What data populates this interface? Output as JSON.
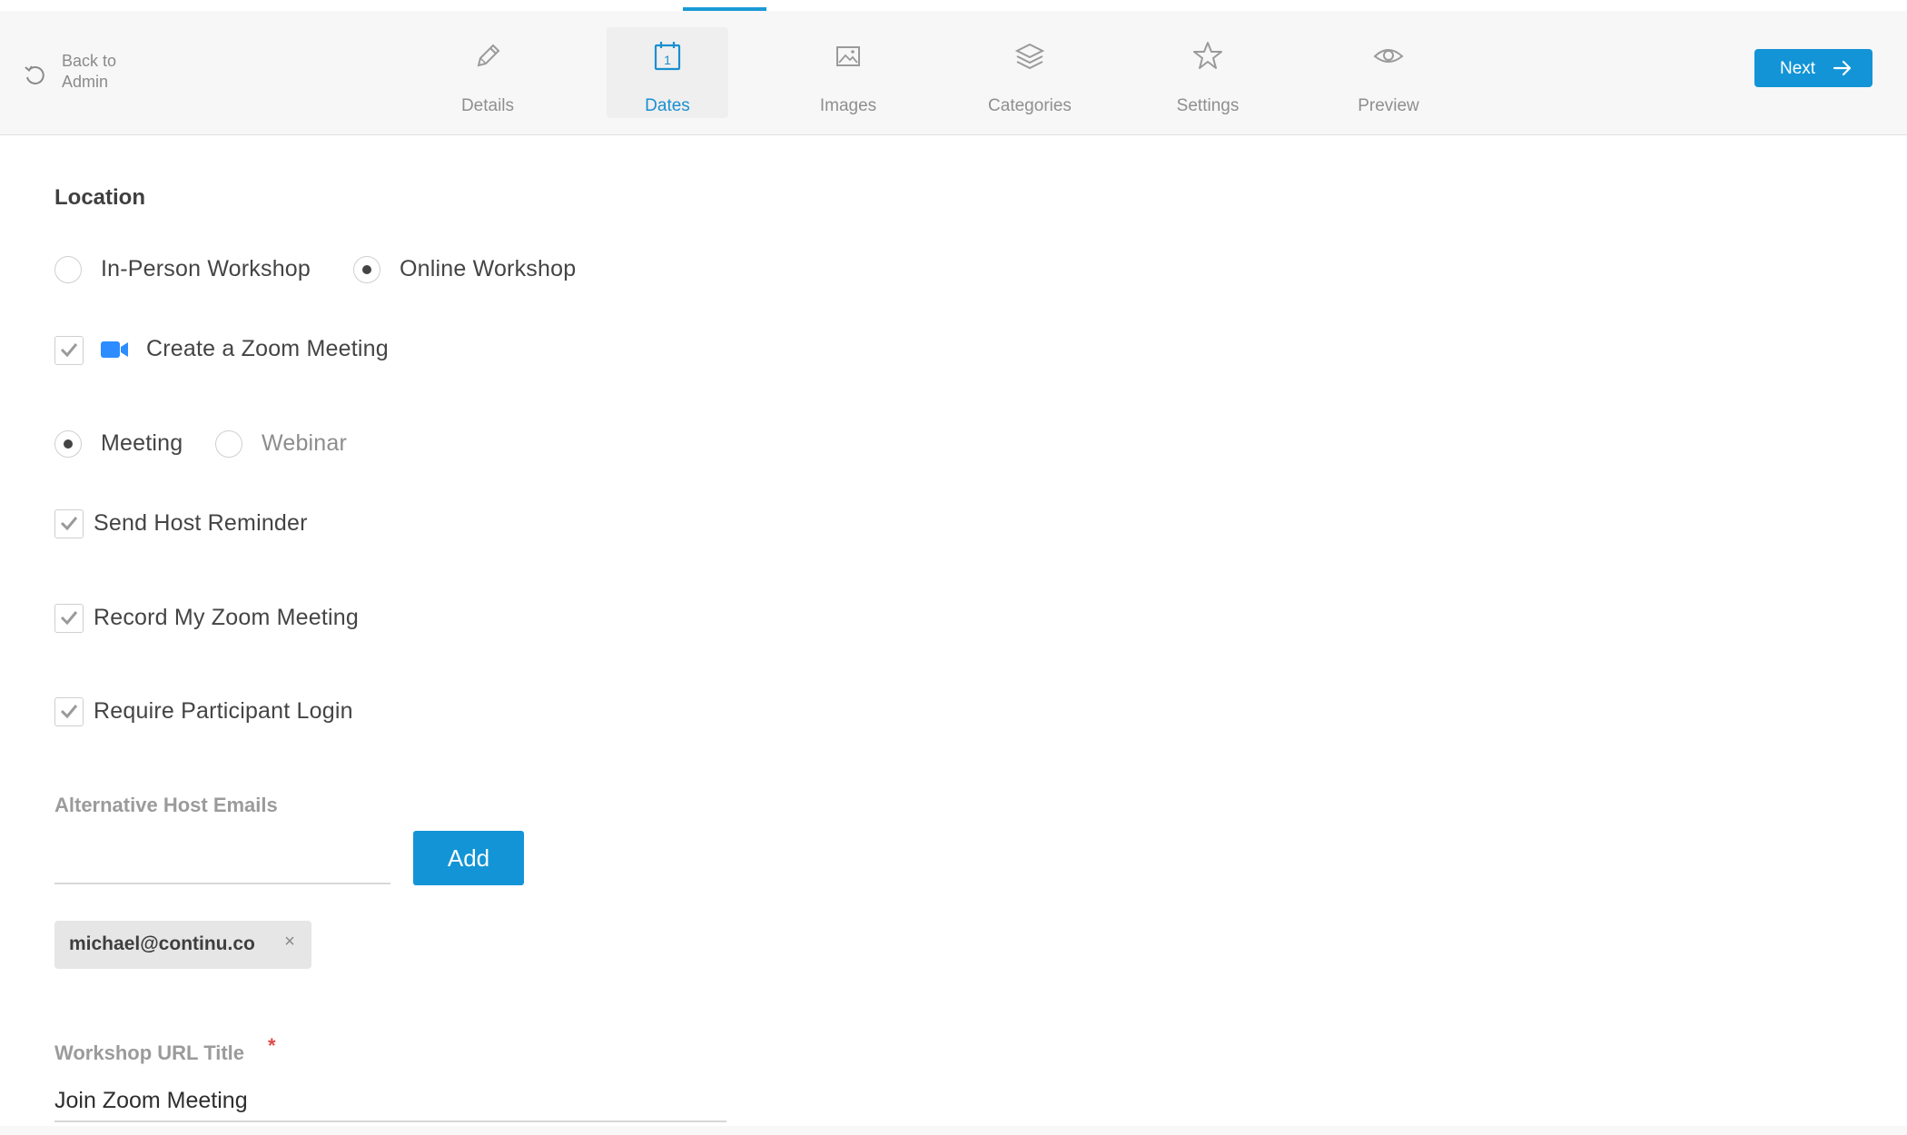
{
  "header": {
    "back_label": "Back to Admin",
    "tabs": [
      {
        "label": "Details",
        "icon": "pencil-icon",
        "active": false
      },
      {
        "label": "Dates",
        "icon": "calendar-icon",
        "active": true
      },
      {
        "label": "Images",
        "icon": "image-icon",
        "active": false
      },
      {
        "label": "Categories",
        "icon": "layers-icon",
        "active": false
      },
      {
        "label": "Settings",
        "icon": "star-icon",
        "active": false
      },
      {
        "label": "Preview",
        "icon": "eye-icon",
        "active": false
      }
    ],
    "next_label": "Next"
  },
  "form": {
    "section_title": "Location",
    "location_type": {
      "options": [
        "In-Person Workshop",
        "Online Workshop"
      ],
      "selected": "Online Workshop"
    },
    "create_zoom": {
      "label": "Create a Zoom Meeting",
      "checked": true
    },
    "meeting_type": {
      "options": [
        "Meeting",
        "Webinar"
      ],
      "selected": "Meeting"
    },
    "send_host_reminder": {
      "label": "Send Host Reminder",
      "checked": true
    },
    "record_meeting": {
      "label": "Record My Zoom Meeting",
      "checked": true
    },
    "require_login": {
      "label": "Require Participant Login",
      "checked": true
    },
    "alt_host_emails": {
      "label": "Alternative Host Emails",
      "input_value": "",
      "add_label": "Add",
      "chips": [
        "michael@continu.co"
      ],
      "chip_remove": "×"
    },
    "workshop_url_title": {
      "label": "Workshop URL Title",
      "required_mark": "*",
      "value": "Join Zoom Meeting"
    }
  },
  "colors": {
    "accent": "#1394d6",
    "active_tab_text": "#1a8fd0",
    "required": "#e04a4a",
    "zoom_icon": "#2d8cff"
  }
}
